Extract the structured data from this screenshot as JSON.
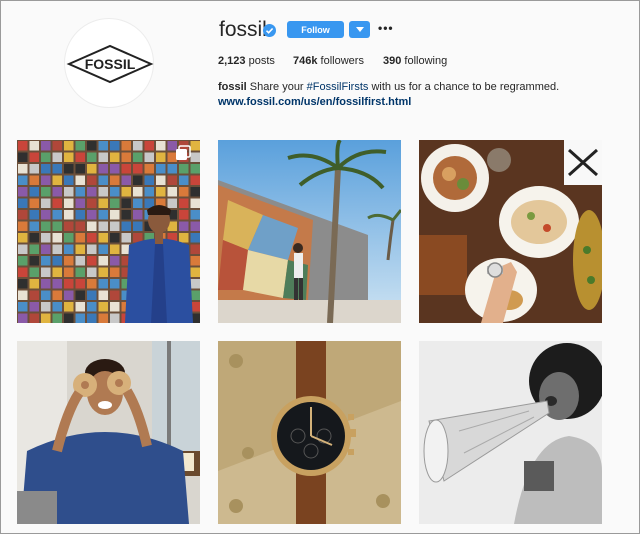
{
  "profile": {
    "logo_text": "FOSSIL",
    "username": "fossil",
    "follow_label": "Follow",
    "posts": {
      "count": "2,123",
      "label": "posts"
    },
    "followers": {
      "count": "746k",
      "label": "followers"
    },
    "following": {
      "count": "390",
      "label": "following"
    },
    "bio": {
      "name": "fossil",
      "text_before": " Share your ",
      "hashtag": "#FossilFirsts",
      "text_after": " with us for a chance to be regrammed."
    },
    "link": "www.fossil.com/us/en/fossilfirst.html"
  },
  "colors": {
    "accent": "#3897f0",
    "link": "#003569",
    "text": "#262626"
  },
  "grid": [
    {
      "name": "post-tiles-wall",
      "icon": "multiple-posts-icon"
    },
    {
      "name": "post-palm-tree"
    },
    {
      "name": "post-food-table"
    },
    {
      "name": "post-donut-eyes"
    },
    {
      "name": "post-watch-closeup"
    },
    {
      "name": "post-megaphone"
    }
  ]
}
